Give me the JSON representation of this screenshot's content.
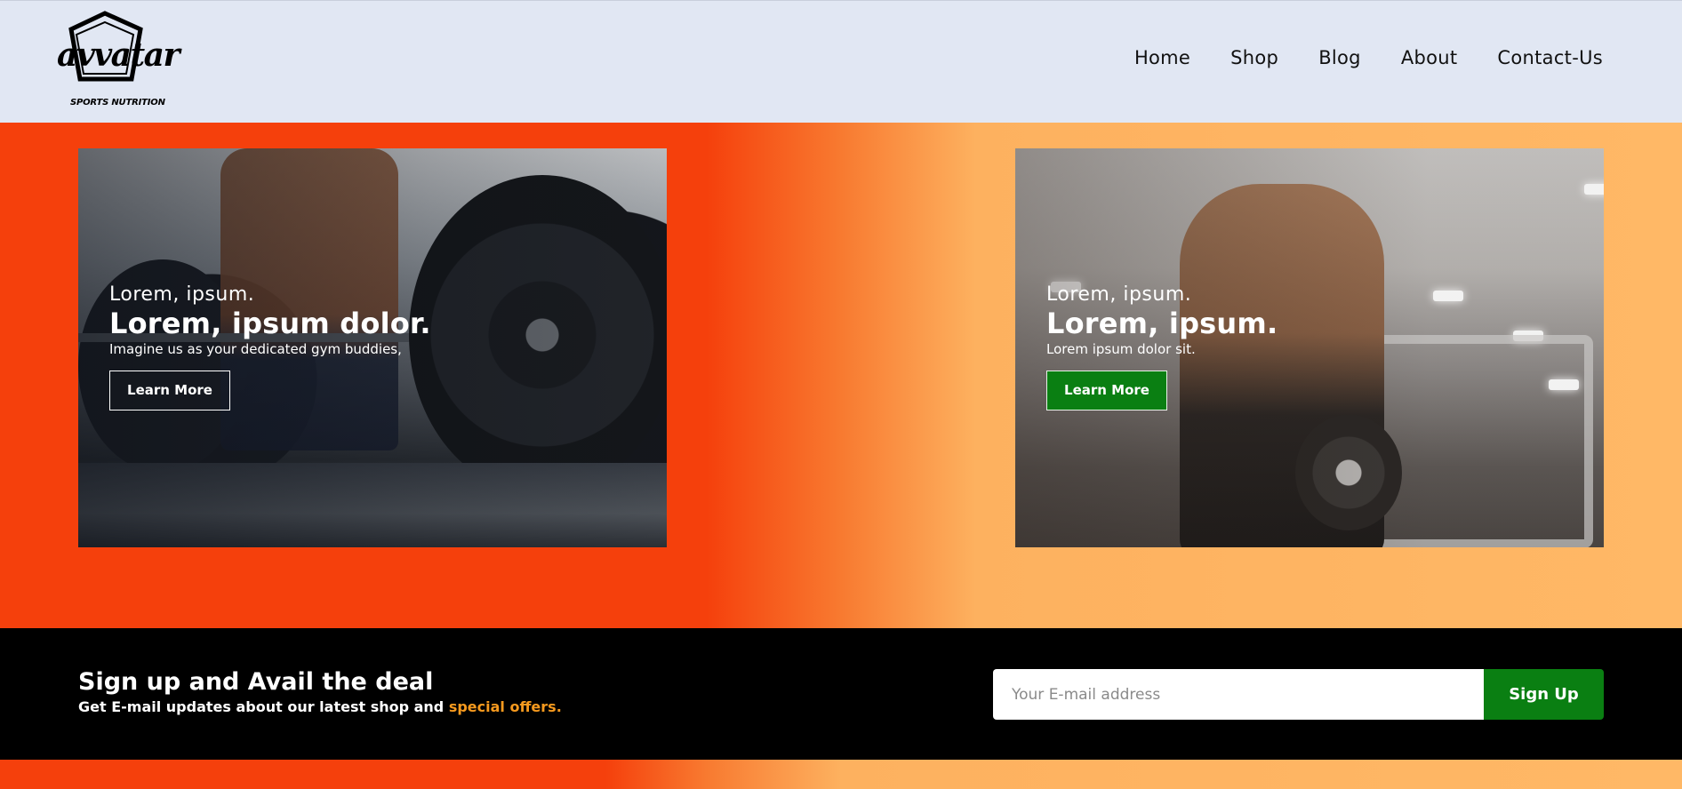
{
  "header": {
    "logo_word": "avvatar",
    "logo_tagline": "SPORTS NUTRITION",
    "nav": [
      {
        "label": "Home"
      },
      {
        "label": "Shop"
      },
      {
        "label": "Blog"
      },
      {
        "label": "About"
      },
      {
        "label": "Contact-Us"
      }
    ]
  },
  "hero": {
    "cards": [
      {
        "kicker": "Lorem, ipsum.",
        "title": "Lorem, ipsum dolor.",
        "subtitle": "Imagine us as your dedicated gym buddies,",
        "button_label": "Learn More",
        "image_icon": "deadlift-barbell-photo"
      },
      {
        "kicker": "Lorem, ipsum.",
        "title": "Lorem, ipsum.",
        "subtitle": "Lorem ipsum dolor sit.",
        "button_label": "Learn More",
        "image_icon": "gym-athlete-photo"
      }
    ]
  },
  "signup": {
    "title": "Sign up and Avail the deal",
    "subtitle_prefix": "Get E-mail updates about our latest shop and ",
    "subtitle_accent": "special offers.",
    "email_placeholder": "Your E-mail address",
    "email_value": "",
    "button_label": "Sign Up"
  },
  "colors": {
    "header_bg": "#e1e7f3",
    "gradient_start": "#f5400c",
    "gradient_end": "#ffb866",
    "signup_bg": "#000000",
    "accent_orange": "#f79a1e",
    "button_green": "#0a7f12"
  }
}
